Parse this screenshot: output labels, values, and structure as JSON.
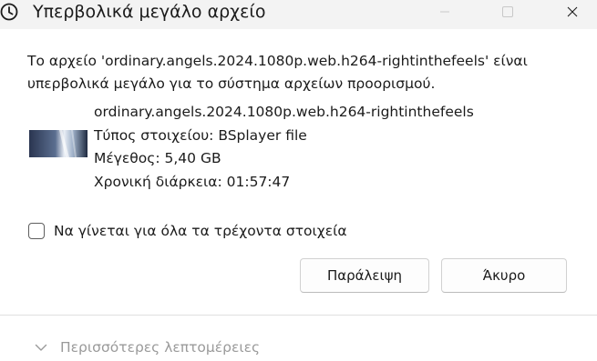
{
  "window": {
    "title": "Υπερβολικά μεγάλο αρχείο",
    "icon": "clock-icon"
  },
  "message": {
    "line1": "Το αρχείο 'ordinary.angels.2024.1080p.web.h264-rightinthefeels' είναι",
    "line2": "υπερβολικά μεγάλο για το σύστημα αρχείων προορισμού."
  },
  "file": {
    "name": "ordinary.angels.2024.1080p.web.h264-rightinthefeels",
    "type": "Τύπος στοιχείου: BSplayer file",
    "size": "Μέγεθος: 5,40 GB",
    "duration": "Χρονική διάρκεια: 01:57:47"
  },
  "checkbox": {
    "label": "Να γίνεται για όλα τα τρέχοντα στοιχεία",
    "checked": false
  },
  "buttons": {
    "skip": "Παράλειψη",
    "cancel": "Άκυρο"
  },
  "footer": {
    "more_details": "Περισσότερες λεπτομέρειες",
    "icon": "chevron-down-icon"
  },
  "colors": {
    "titlebar_bg": "#f3f3f3",
    "text": "#1b1b1b",
    "muted_text": "#9a9a9a",
    "window_controls": "#c8c8c8"
  }
}
